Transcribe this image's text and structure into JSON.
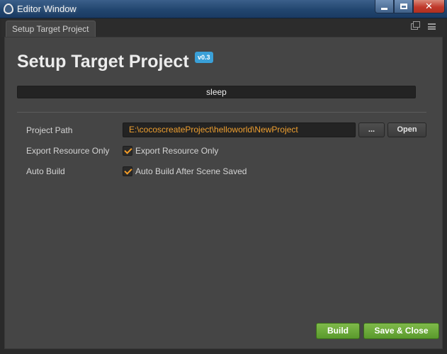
{
  "window": {
    "title": "Editor Window",
    "close_glyph": "✕"
  },
  "tab": {
    "label": "Setup Target Project"
  },
  "main": {
    "heading": "Setup Target Project",
    "version": "v0.3",
    "status": "sleep"
  },
  "form": {
    "project_path": {
      "label": "Project Path",
      "value": "E:\\cocoscreateProject\\helloworld\\NewProject",
      "browse_label": "...",
      "open_label": "Open"
    },
    "export_resource_only": {
      "label": "Export Resource Only",
      "checkbox_label": "Export Resource Only",
      "checked": true
    },
    "auto_build": {
      "label": "Auto Build",
      "checkbox_label": "Auto Build After Scene Saved",
      "checked": true
    }
  },
  "actions": {
    "build_label": "Build",
    "save_close_label": "Save & Close"
  },
  "colors": {
    "accent_orange": "#f39c28",
    "path_text": "#f0a030",
    "badge_blue": "#3aa0d8",
    "button_green": "#6aaa38",
    "panel_bg": "#454545"
  },
  "icons": [
    "app-drop-icon",
    "minimize-icon",
    "maximize-icon",
    "close-icon",
    "popout-icon",
    "menu-icon",
    "checkmark-icon"
  ]
}
